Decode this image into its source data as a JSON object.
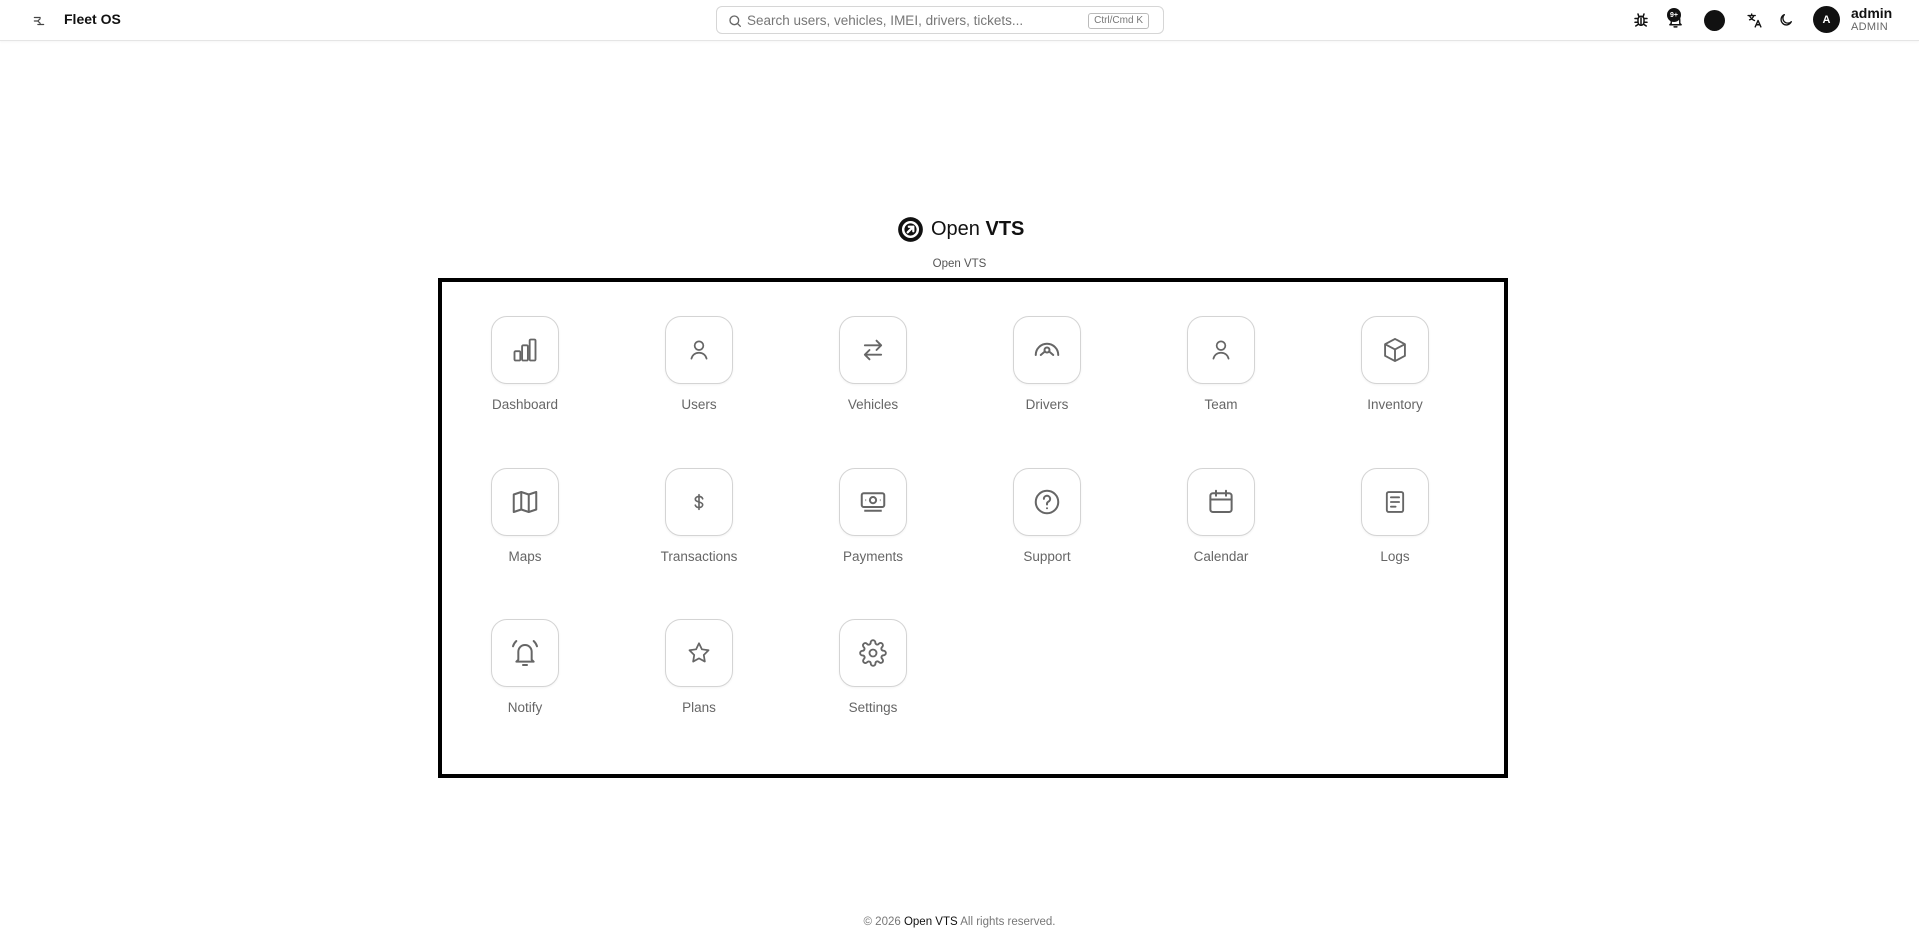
{
  "topbar": {
    "brand": "Fleet OS",
    "search": {
      "placeholder": "Search users, vehicles, IMEI, drivers, tickets...",
      "shortcut": "Ctrl/Cmd K"
    },
    "notifications_badge": "9+",
    "user": {
      "avatar_initial": "A",
      "name": "admin",
      "role": "ADMIN"
    }
  },
  "logo": {
    "text_part1": "Open ",
    "text_part2": "VTS"
  },
  "subtitle": "Open VTS",
  "apps": [
    {
      "label": "Dashboard",
      "icon": "bar-chart-icon"
    },
    {
      "label": "Users",
      "icon": "user-icon"
    },
    {
      "label": "Vehicles",
      "icon": "arrows-left-right-icon"
    },
    {
      "label": "Drivers",
      "icon": "steering-wheel-icon"
    },
    {
      "label": "Team",
      "icon": "user-icon"
    },
    {
      "label": "Inventory",
      "icon": "box-icon"
    },
    {
      "label": "Maps",
      "icon": "map-icon"
    },
    {
      "label": "Transactions",
      "icon": "dollar-icon"
    },
    {
      "label": "Payments",
      "icon": "banknote-icon"
    },
    {
      "label": "Support",
      "icon": "help-circle-icon"
    },
    {
      "label": "Calendar",
      "icon": "calendar-icon"
    },
    {
      "label": "Logs",
      "icon": "document-icon"
    },
    {
      "label": "Notify",
      "icon": "bell-ring-icon"
    },
    {
      "label": "Plans",
      "icon": "star-icon"
    },
    {
      "label": "Settings",
      "icon": "gear-icon"
    }
  ],
  "footer": {
    "prefix": "© 2026 ",
    "brand": "Open VTS",
    "suffix": " All rights reserved."
  }
}
